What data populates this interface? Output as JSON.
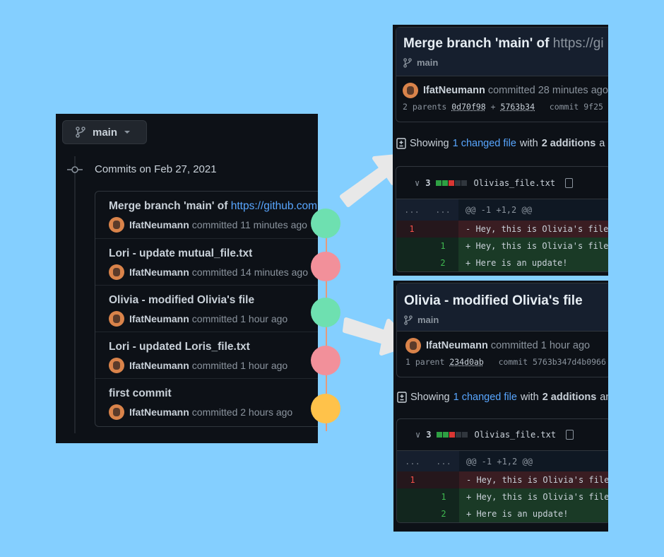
{
  "left": {
    "branch_label": "main",
    "commits_header": "Commits on Feb 27, 2021",
    "commits": [
      {
        "title": "Merge branch 'main' of ",
        "link": "https://github.com",
        "author": "IfatNeumann",
        "meta": "committed 11 minutes ago"
      },
      {
        "title": "Lori - update mutual_file.txt",
        "author": "IfatNeumann",
        "meta": "committed 14 minutes ago"
      },
      {
        "title": "Olivia - modified Olivia's file",
        "author": "IfatNeumann",
        "meta": "committed 1 hour ago"
      },
      {
        "title": "Lori - updated Loris_file.txt",
        "author": "IfatNeumann",
        "meta": "committed 1 hour ago"
      },
      {
        "title": "first commit",
        "author": "IfatNeumann",
        "meta": "committed 2 hours ago"
      }
    ]
  },
  "graph_dot_colors": [
    "#6ee0b0",
    "#f2909a",
    "#6ee0b0",
    "#f2909a",
    "#ffc24a"
  ],
  "colors": {
    "background": "#84cfff",
    "panel": "#0d1117",
    "link": "#58a6ff",
    "addition": "#2ea043",
    "deletion": "#da3633",
    "arrow": "#e8e8e8"
  },
  "top_detail": {
    "title": "Merge branch 'main' of ",
    "title_link": "https://gi",
    "branch": "main",
    "author": "IfatNeumann",
    "meta": "committed 28 minutes ago",
    "parents_label": "2 parents",
    "parent1": "0d70f98",
    "plus": "+",
    "parent2": "5763b34",
    "commit_label": "commit 9f25",
    "showing": "Showing",
    "changed": "1 changed file",
    "with": "with",
    "additions": "2 additions",
    "tail": "a",
    "file": {
      "count": "3",
      "name": "Olivias_file.txt",
      "hunk_left": "...",
      "hunk_right": "...",
      "hunk": "@@ -1 +1,2 @@",
      "lines": [
        {
          "old": "1",
          "new": "",
          "type": "del",
          "text": "- Hey, this is Olivia's file"
        },
        {
          "old": "",
          "new": "1",
          "type": "add",
          "text": "+ Hey, this is Olivia's file"
        },
        {
          "old": "",
          "new": "2",
          "type": "add",
          "text": "+ Here is an update!"
        }
      ]
    }
  },
  "bottom_detail": {
    "title": "Olivia - modified Olivia's file",
    "branch": "main",
    "author": "IfatNeumann",
    "meta": "committed 1 hour ago",
    "parents_label": "1 parent",
    "parent1": "234d0ab",
    "commit_label": "commit 5763b347d4b0966",
    "showing": "Showing",
    "changed": "1 changed file",
    "with": "with",
    "additions": "2 additions",
    "tail": "an",
    "file": {
      "count": "3",
      "name": "Olivias_file.txt",
      "hunk_left": "...",
      "hunk_right": "...",
      "hunk": "@@ -1 +1,2 @@",
      "lines": [
        {
          "old": "1",
          "new": "",
          "type": "del",
          "text": "- Hey, this is Olivia's file"
        },
        {
          "old": "",
          "new": "1",
          "type": "add",
          "text": "+ Hey, this is Olivia's file"
        },
        {
          "old": "",
          "new": "2",
          "type": "add",
          "text": "+ Here is an update!"
        }
      ]
    }
  }
}
